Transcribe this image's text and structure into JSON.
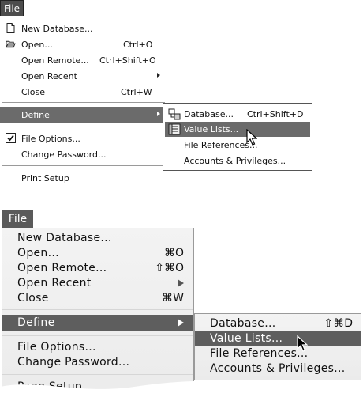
{
  "windows": {
    "menu_title": "File",
    "items": [
      {
        "label": "New Database...",
        "shortcut": "",
        "icon": "new-document-icon"
      },
      {
        "label": "Open...",
        "shortcut": "Ctrl+O",
        "icon": "open-folder-icon"
      },
      {
        "label": "Open Remote...",
        "shortcut": "Ctrl+Shift+O"
      },
      {
        "label": "Open Recent",
        "shortcut": ""
      },
      {
        "label": "Close",
        "shortcut": "Ctrl+W"
      },
      {
        "label": "Define",
        "shortcut": ""
      },
      {
        "label": "File Options...",
        "shortcut": "",
        "icon": "checkmark-icon"
      },
      {
        "label": "Change Password...",
        "shortcut": ""
      },
      {
        "label": "Print Setup",
        "shortcut": ""
      }
    ],
    "submenu": [
      {
        "label": "Database...",
        "shortcut": "Ctrl+Shift+D",
        "icon": "database-icon"
      },
      {
        "label": "Value Lists...",
        "shortcut": "",
        "icon": "value-list-icon"
      },
      {
        "label": "File References...",
        "shortcut": ""
      },
      {
        "label": "Accounts & Privileges...",
        "shortcut": ""
      }
    ],
    "highlight_color": "#6b6b6b"
  },
  "mac": {
    "menu_title": "File",
    "items": [
      {
        "label": "New Database...",
        "shortcut": ""
      },
      {
        "label": "Open...",
        "shortcut": "⌘O"
      },
      {
        "label": "Open Remote...",
        "shortcut": "⇧⌘O"
      },
      {
        "label": "Open Recent",
        "shortcut": ""
      },
      {
        "label": "Close",
        "shortcut": "⌘W"
      },
      {
        "label": "Define",
        "shortcut": ""
      },
      {
        "label": "File Options...",
        "shortcut": ""
      },
      {
        "label": "Change Password...",
        "shortcut": ""
      },
      {
        "label": "Page Setup",
        "shortcut": ""
      }
    ],
    "submenu": [
      {
        "label": "Database...",
        "shortcut": "⇧⌘D"
      },
      {
        "label": "Value Lists...",
        "shortcut": ""
      },
      {
        "label": "File References...",
        "shortcut": ""
      },
      {
        "label": "Accounts & Privileges...",
        "shortcut": ""
      }
    ],
    "highlight_color": "#5e5e5e"
  }
}
